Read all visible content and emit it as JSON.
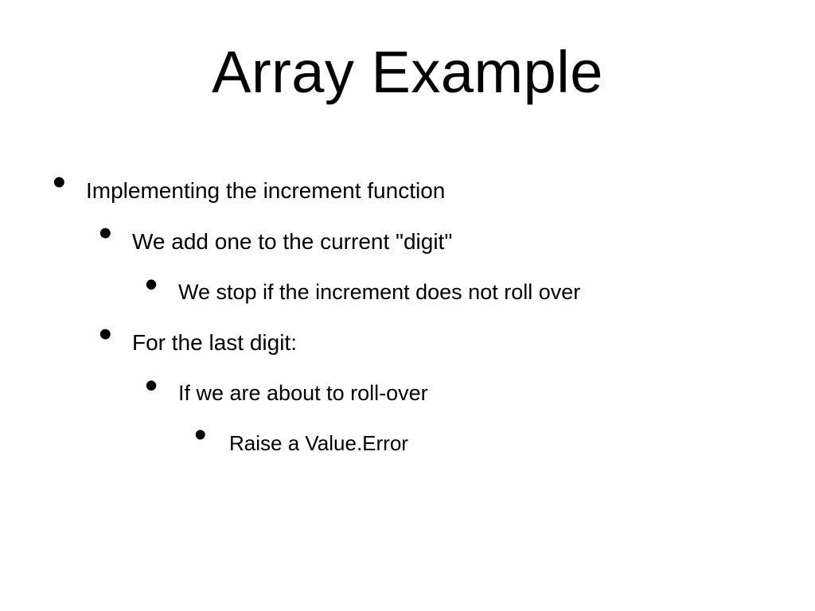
{
  "slide": {
    "title": "Array Example",
    "bullets": {
      "l1": "Implementing the increment function",
      "l2a": "We add one to the current \"digit\"",
      "l3a": "We stop if the increment does not roll over",
      "l2b": "For the last digit:",
      "l3b": "If we are about to roll-over",
      "l4a": "Raise a Value.Error"
    }
  }
}
